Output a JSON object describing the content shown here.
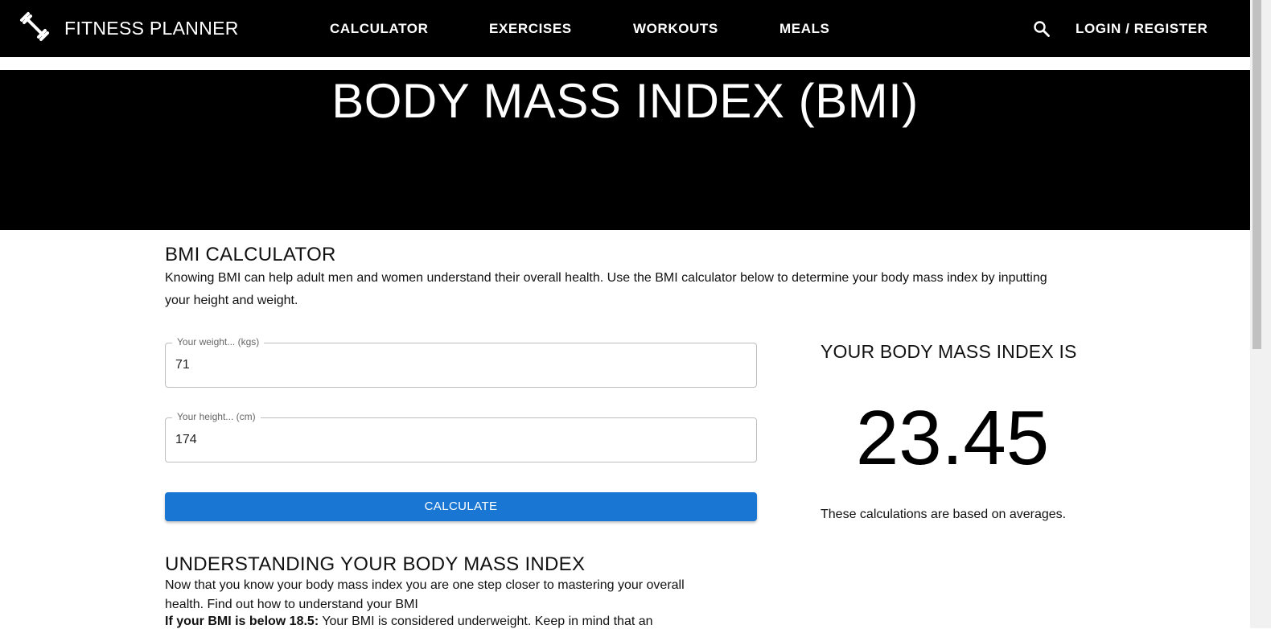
{
  "navbar": {
    "brand": "FITNESS PLANNER",
    "links": [
      "CALCULATOR",
      "EXERCISES",
      "WORKOUTS",
      "MEALS"
    ],
    "login_label": "LOGIN / REGISTER",
    "icons": {
      "logo": "dumbbell-icon",
      "search": "search-icon"
    }
  },
  "hero": {
    "title": "BODY MASS INDEX (BMI)"
  },
  "calculator": {
    "title": "BMI CALCULATOR",
    "description": "Knowing BMI can help adult men and women understand their overall health. Use the BMI calculator below to determine your body mass index by inputting your height and weight.",
    "weight_label": "Your weight... (kgs)",
    "weight_value": "71",
    "height_label": "Your height... (cm)",
    "height_value": "174",
    "button_label": "CALCULATE"
  },
  "result": {
    "heading": "YOUR BODY MASS INDEX IS",
    "value": "23.45",
    "note": "These calculations are based on averages."
  },
  "understanding": {
    "title": "UNDERSTANDING YOUR BODY MASS INDEX",
    "text": "Now that you know your body mass index you are one step closer to mastering your overall health. Find out how to understand your BMI",
    "cutoff_bold": "If your BMI is below 18.5:",
    "cutoff_text": " Your BMI is considered underweight. Keep in mind that an"
  },
  "colors": {
    "primary_button": "#1976d2",
    "header_bg": "#000000"
  }
}
